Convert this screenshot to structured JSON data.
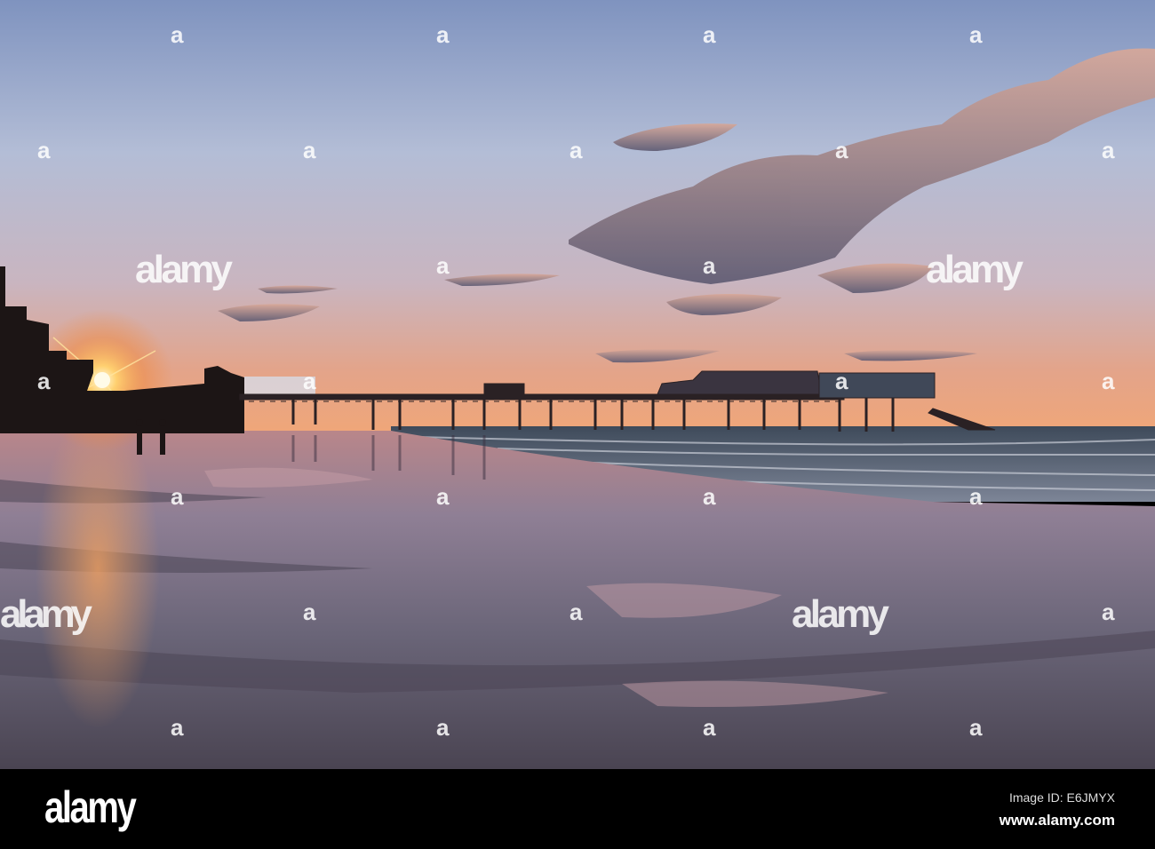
{
  "photo": {
    "subject": "Sunset over pier and wet beach",
    "watermark_text": "alamy",
    "colors": {
      "sky_top": "#8aa0c8",
      "sky_mid": "#b9c2d8",
      "sky_horizon": "#e9a27a",
      "sun": "#fff2b0",
      "silhouette": "#1a1414"
    }
  },
  "footer": {
    "logo": "alamy",
    "image_id": "Image ID: E6JMYX",
    "url": "www.alamy.com"
  }
}
